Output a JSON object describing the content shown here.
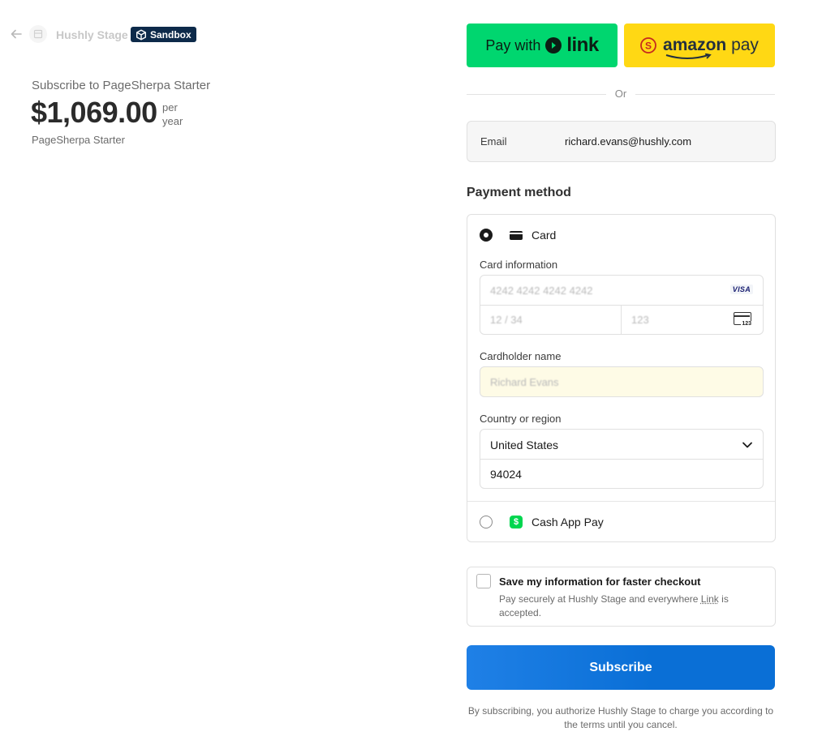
{
  "header": {
    "merchant_name": "Hushly Stage",
    "sandbox_label": "Sandbox"
  },
  "summary": {
    "subscribe_to": "Subscribe to PageSherpa Starter",
    "price": "$1,069.00",
    "period_line1": "per",
    "period_line2": "year",
    "product_name": "PageSherpa Starter"
  },
  "express": {
    "link_prefix": "Pay with",
    "link_brand": "link",
    "amazon_brand": "amazon",
    "amazon_pay": "pay",
    "divider": "Or"
  },
  "contact": {
    "email_label": "Email",
    "email_value": "richard.evans@hushly.com"
  },
  "payment": {
    "title": "Payment method",
    "card_label": "Card",
    "card_info_label": "Card information",
    "card_number": "4242 4242 4242 4242",
    "card_brand": "VISA",
    "expiry": "12 / 34",
    "cvc": "123",
    "cvc_icon_text": "123",
    "cardholder_label": "Cardholder name",
    "cardholder_value": "Richard Evans",
    "country_label": "Country or region",
    "country_value": "United States",
    "zip_value": "94024",
    "cashapp_label": "Cash App Pay",
    "cashapp_glyph": "$"
  },
  "save": {
    "title": "Save my information for faster checkout",
    "desc_before": "Pay securely at Hushly Stage and everywhere ",
    "desc_link": "Link",
    "desc_after": " is accepted."
  },
  "actions": {
    "subscribe_label": "Subscribe",
    "terms": "By subscribing, you authorize Hushly Stage to charge you according to the terms until you cancel."
  },
  "colors": {
    "link_green": "#00d66f",
    "amazon_yellow": "#ffd814",
    "subscribe_blue": "#0a6fd6",
    "sandbox_navy": "#0d2a4a"
  }
}
